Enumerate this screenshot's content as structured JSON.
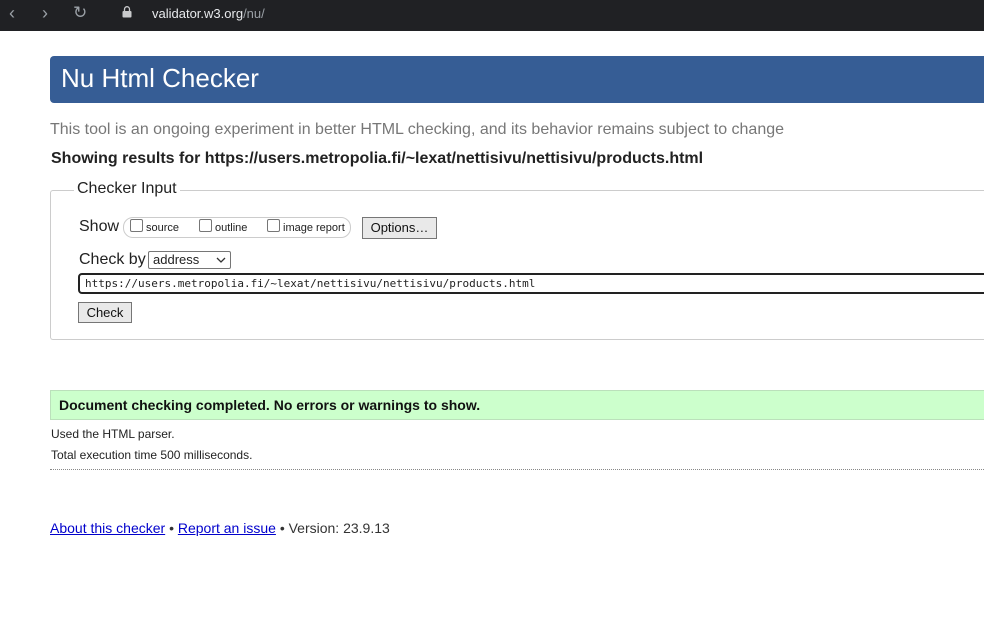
{
  "browser": {
    "back_icon": "‹",
    "forward_icon": "›",
    "reload_icon": "↻",
    "url_domain": "validator.w3.org",
    "url_path": "/nu/"
  },
  "header": {
    "title": "Nu Html Checker"
  },
  "intro": {
    "tagline": "This tool is an ongoing experiment in better HTML checking, and its behavior remains subject to change",
    "showing": "Showing results for https://users.metropolia.fi/~lexat/nettisivu/nettisivu/products.html"
  },
  "checker_input": {
    "legend": "Checker Input",
    "show_label": "Show",
    "options": [
      {
        "label": "source",
        "checked": false
      },
      {
        "label": "outline",
        "checked": false
      },
      {
        "label": "image report",
        "checked": false
      }
    ],
    "options_button": "Options…",
    "check_by_label": "Check by",
    "check_by_value": "address",
    "url_value": "https://users.metropolia.fi/~lexat/nettisivu/nettisivu/products.html",
    "check_button": "Check"
  },
  "results": {
    "status": "Document checking completed. No errors or warnings to show.",
    "parser": "Used the HTML parser.",
    "time": "Total execution time 500 milliseconds."
  },
  "footer": {
    "about_link": "About this checker",
    "separator": "•",
    "report_link": "Report an issue",
    "version": "Version: 23.9.13"
  }
}
